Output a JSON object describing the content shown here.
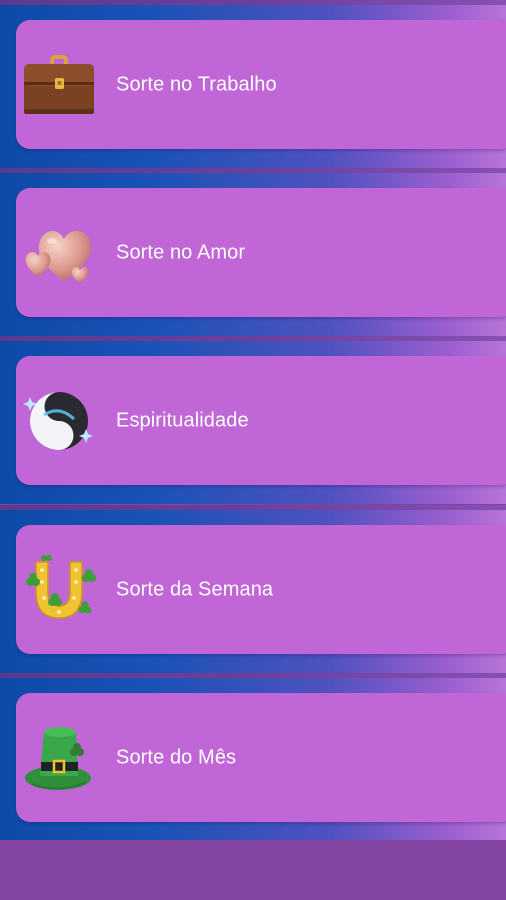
{
  "menu": {
    "items": [
      {
        "label": "Sorte no Trabalho",
        "icon": "briefcase-icon"
      },
      {
        "label": "Sorte no Amor",
        "icon": "hearts-icon"
      },
      {
        "label": "Espiritualidade",
        "icon": "yin-yang-icon"
      },
      {
        "label": "Sorte da Semana",
        "icon": "horseshoe-icon"
      },
      {
        "label": "Sorte do Mês",
        "icon": "leprechaun-hat-icon"
      }
    ]
  },
  "colors": {
    "card": "#c066d6",
    "row_gradient_start": "#0d4aa8",
    "row_gradient_end": "#b774d8",
    "bottom_bar": "#8545a3",
    "label_text": "#ffffff"
  }
}
